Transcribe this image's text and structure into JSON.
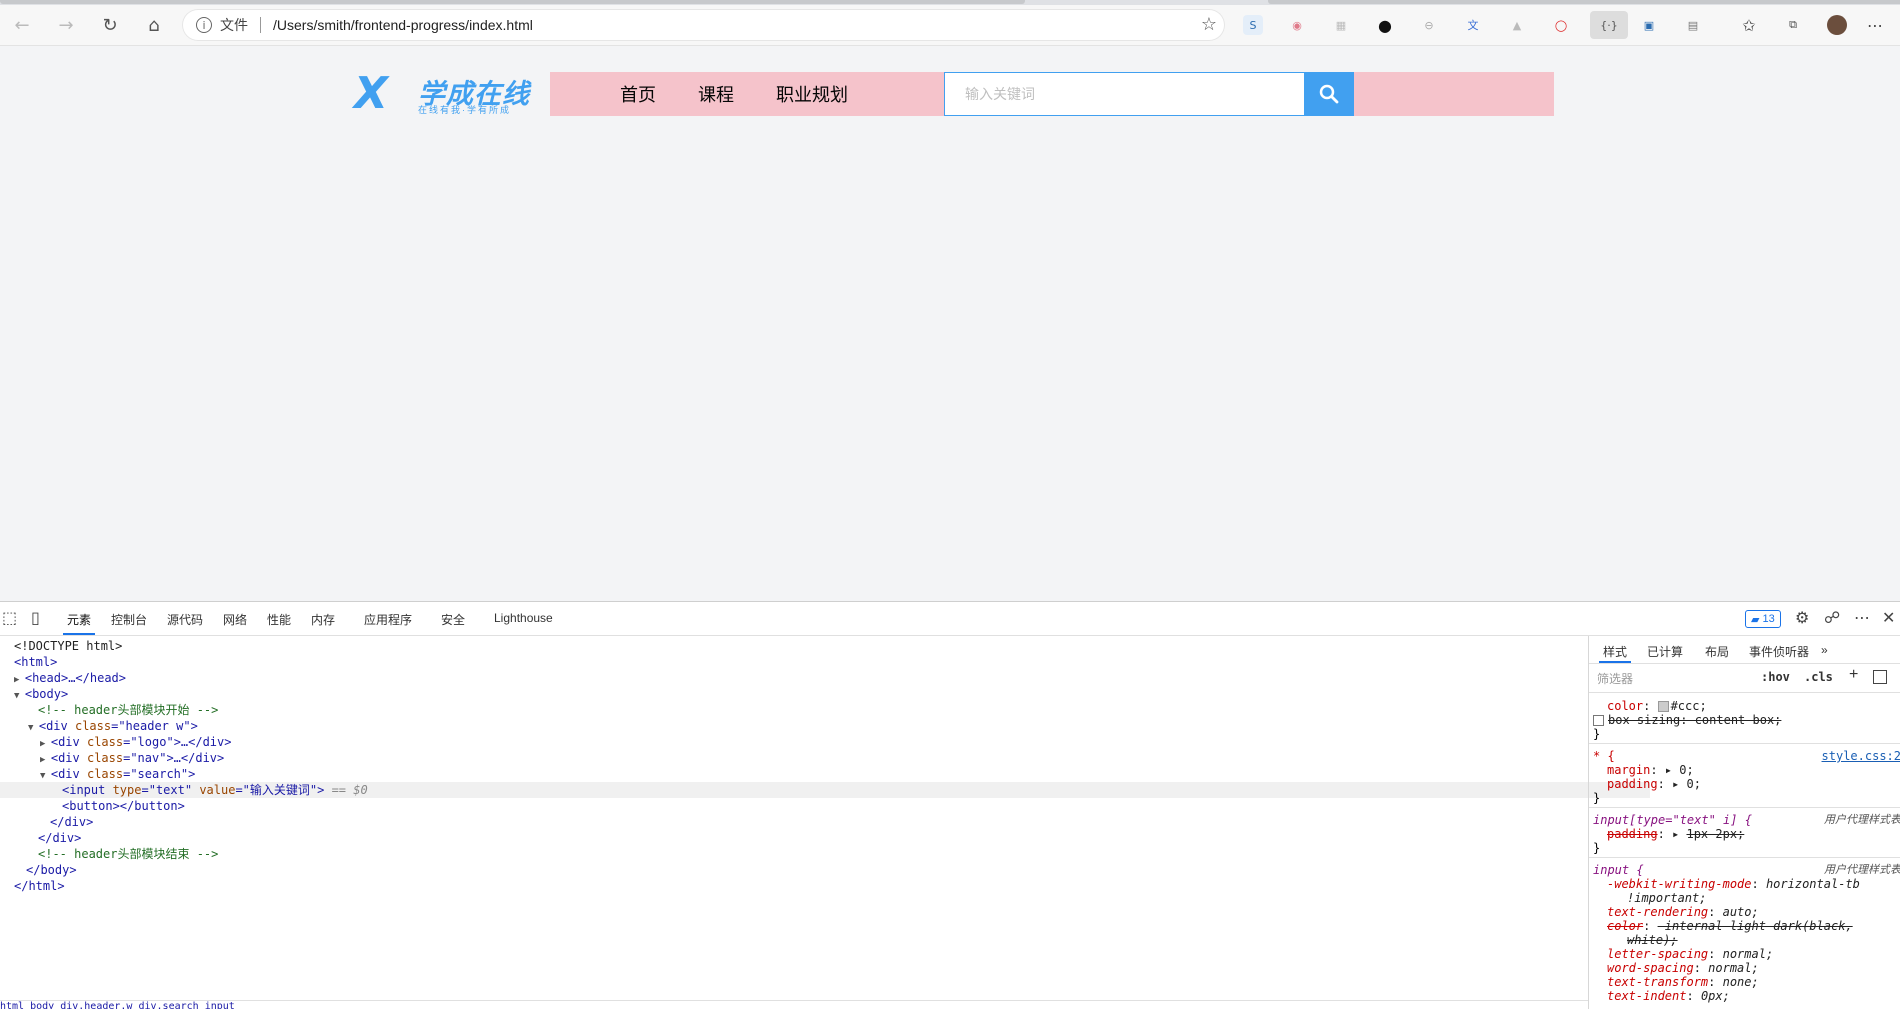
{
  "browser": {
    "address_label": "文件",
    "url": "/Users/smith/frontend-progress/index.html"
  },
  "page": {
    "logo": {
      "mark": "X",
      "name": "学成在线",
      "slogan": "在线有我·学有所成"
    },
    "nav": [
      "首页",
      "课程",
      "职业规划"
    ],
    "search_placeholder": "输入关键词"
  },
  "devtools": {
    "tabs": [
      "元素",
      "控制台",
      "源代码",
      "网络",
      "性能",
      "内存",
      "应用程序",
      "安全",
      "Lighthouse"
    ],
    "issues_count": "13",
    "dom_lines": {
      "l1": "<!DOCTYPE html>",
      "l2": "<html>",
      "l3": "<head>…</head>",
      "l4": "<body>",
      "l5": "<!-- header头部模块开始 -->",
      "l6_tag": "<div ",
      "l6_attr": "class",
      "l6_val": "\"header w\"",
      "l7_attr": "class",
      "l7_val": "\"logo\"",
      "l8_attr": "class",
      "l8_val": "\"nav\"",
      "l9_attr": "class",
      "l9_val": "\"search\"",
      "l10_type_attr": "type",
      "l10_type_val": "\"text\"",
      "l10_value_attr": "value",
      "l10_value_val": "\"输入关键词\"",
      "l10_ref": "== $0",
      "l11": "<button></button>",
      "l12": "</div>",
      "l13": "</div>",
      "l14": "<!-- header头部模块结束 -->",
      "l15": "</body>",
      "l16": "</html>"
    },
    "styles": {
      "tabs": [
        "样式",
        "已计算",
        "布局",
        "事件侦听器"
      ],
      "filter_placeholder": "筛选器",
      "hov": ":hov",
      "cls": ".cls",
      "rule0_color_prop": "color",
      "rule0_color_val": "#ccc;",
      "rule0_boxsizing": "box-sizing: content-box;",
      "rule1_selector": "* {",
      "rule1_source": "style.css:2",
      "rule1_margin_prop": "margin",
      "rule1_margin_val": "0;",
      "rule1_padding_prop": "padding",
      "rule1_padding_val": "0;",
      "rule2_selector": "input[type=\"text\" i] {",
      "rule2_source": "用户代理样式表",
      "rule2_padding_prop": "padding",
      "rule2_padding_val": "1px 2px;",
      "rule3_selector": "input {",
      "rule3_source": "用户代理样式表",
      "rule3_lines": [
        {
          "prop": "-webkit-writing-mode",
          "val": "horizontal-tb"
        },
        {
          "prop": "",
          "val": "!important;"
        },
        {
          "prop": "text-rendering",
          "val": "auto;"
        },
        {
          "prop": "color",
          "val": "-internal-light-dark(black,"
        },
        {
          "prop": "",
          "val": "white);"
        },
        {
          "prop": "letter-spacing",
          "val": "normal;"
        },
        {
          "prop": "word-spacing",
          "val": "normal;"
        },
        {
          "prop": "text-transform",
          "val": "none;"
        },
        {
          "prop": "text-indent",
          "val": "0px;"
        }
      ]
    },
    "breadcrumbs": "html  body  div.header.w  div.search  input"
  },
  "colors": {
    "brand_blue": "#41a0f0",
    "header_pink": "#f5c3cb",
    "page_bg": "#f3f4f6"
  }
}
